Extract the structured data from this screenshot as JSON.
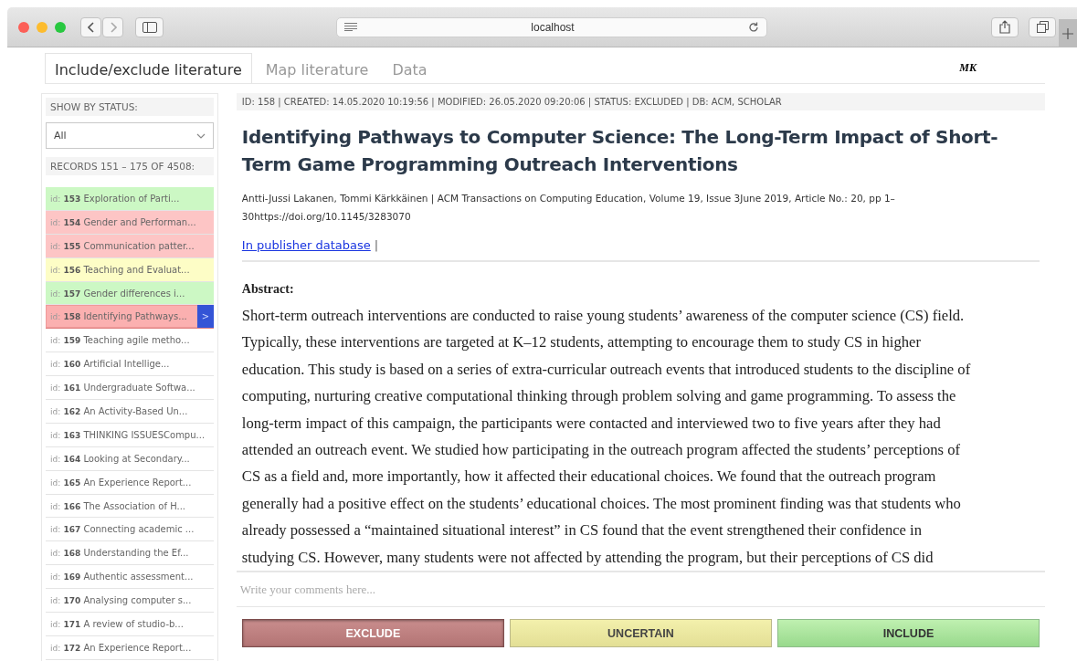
{
  "browser": {
    "address": "localhost"
  },
  "tabs": [
    {
      "label": "Include/exclude literature",
      "selected": true
    },
    {
      "label": "Map literature",
      "selected": false
    },
    {
      "label": "Data",
      "selected": false
    }
  ],
  "user_initials": "MK",
  "sidebar": {
    "filter_label": "SHOW BY STATUS:",
    "filter_value": "All",
    "records_label": "RECORDS 151 – 175 OF 4508:",
    "items": [
      {
        "prefix": "id:",
        "id": "153",
        "title": "Exploration of Parti...",
        "color": "#ccf8c4",
        "selected": false
      },
      {
        "prefix": "id:",
        "id": "154",
        "title": "Gender and Performan...",
        "color": "#fdc5c5",
        "selected": false
      },
      {
        "prefix": "id:",
        "id": "155",
        "title": "Communication patter...",
        "color": "#fdc5c5",
        "selected": false
      },
      {
        "prefix": "id:",
        "id": "156",
        "title": "Teaching and Evaluat...",
        "color": "#fdfdc6",
        "selected": false
      },
      {
        "prefix": "id:",
        "id": "157",
        "title": "Gender differences i...",
        "color": "#ccf8c4",
        "selected": false
      },
      {
        "prefix": "id:",
        "id": "158",
        "title": "Identifying Pathways...",
        "color": "#fbb0b0",
        "selected": true,
        "open_label": ">"
      },
      {
        "prefix": "id:",
        "id": "159",
        "title": "Teaching agile metho...",
        "color": "#ffffff",
        "selected": false
      },
      {
        "prefix": "id:",
        "id": "160",
        "title": "Artificial Intellige...",
        "color": "#ffffff",
        "selected": false
      },
      {
        "prefix": "id:",
        "id": "161",
        "title": "Undergraduate Softwa...",
        "color": "#ffffff",
        "selected": false
      },
      {
        "prefix": "id:",
        "id": "162",
        "title": "An Activity-Based Un...",
        "color": "#ffffff",
        "selected": false
      },
      {
        "prefix": "id:",
        "id": "163",
        "title": "THINKING ISSUESCompu...",
        "color": "#ffffff",
        "selected": false
      },
      {
        "prefix": "id:",
        "id": "164",
        "title": "Looking at Secondary...",
        "color": "#ffffff",
        "selected": false
      },
      {
        "prefix": "id:",
        "id": "165",
        "title": "An Experience Report...",
        "color": "#ffffff",
        "selected": false
      },
      {
        "prefix": "id:",
        "id": "166",
        "title": "The Association of H...",
        "color": "#ffffff",
        "selected": false
      },
      {
        "prefix": "id:",
        "id": "167",
        "title": "Connecting academic ...",
        "color": "#ffffff",
        "selected": false
      },
      {
        "prefix": "id:",
        "id": "168",
        "title": "Understanding the Ef...",
        "color": "#ffffff",
        "selected": false
      },
      {
        "prefix": "id:",
        "id": "169",
        "title": "Authentic assessment...",
        "color": "#ffffff",
        "selected": false
      },
      {
        "prefix": "id:",
        "id": "170",
        "title": "Analysing computer s...",
        "color": "#ffffff",
        "selected": false
      },
      {
        "prefix": "id:",
        "id": "171",
        "title": "A review of studio-b...",
        "color": "#ffffff",
        "selected": false
      },
      {
        "prefix": "id:",
        "id": "172",
        "title": "An Experience Report...",
        "color": "#ffffff",
        "selected": false
      }
    ]
  },
  "record": {
    "meta": "ID: 158 | CREATED: 14.05.2020 10:19:56 | MODIFIED: 26.05.2020 09:20:06 | STATUS: EXCLUDED | DB: ACM, SCHOLAR",
    "title": "Identifying Pathways to Computer Science: The Long-Term Impact of Short-Term Game Programming Outreach Interventions",
    "citation": "Antti-Jussi Lakanen, Tommi Kärkkäinen | ACM Transactions on Computing Education, Volume 19, Issue 3June 2019, Article No.: 20, pp 1–30https://doi.org/10.1145/3283070",
    "link": "In publisher database",
    "link_separator": "|",
    "abstract_heading": "Abstract:",
    "abstract_lines": [
      "Short-term outreach interventions are conducted to raise young students’ awareness of the computer science (CS) field.",
      "Typically, these interventions are targeted at K–12 students, attempting to encourage them to study CS in higher",
      "education. This study is based on a series of extra-curricular outreach events that introduced students to the discipline of",
      "computing, nurturing creative computational thinking through problem solving and game programming. To assess the",
      "long-term impact of this campaign, the participants were contacted and interviewed two to five years after they had",
      "attended an outreach event. We studied how participating in the outreach program affected the students’ perceptions of",
      "CS as a field and, more importantly, how it affected their educational choices. We found that the outreach program",
      "generally had a positive effect on the students’ educational choices. The most prominent finding was that students who",
      "already possessed a “maintained situational interest” in CS found that the event strengthened their confidence in",
      "studying CS. However, many students were not affected by attending the program, but their perceptions of CS did"
    ],
    "comment_placeholder": "Write your comments here..."
  },
  "actions": [
    {
      "kind": "exclude",
      "label": "EXCLUDE",
      "selected": true
    },
    {
      "kind": "uncertain",
      "label": "UNCERTAIN",
      "selected": false
    },
    {
      "kind": "include",
      "label": "INCLUDE",
      "selected": false
    }
  ]
}
